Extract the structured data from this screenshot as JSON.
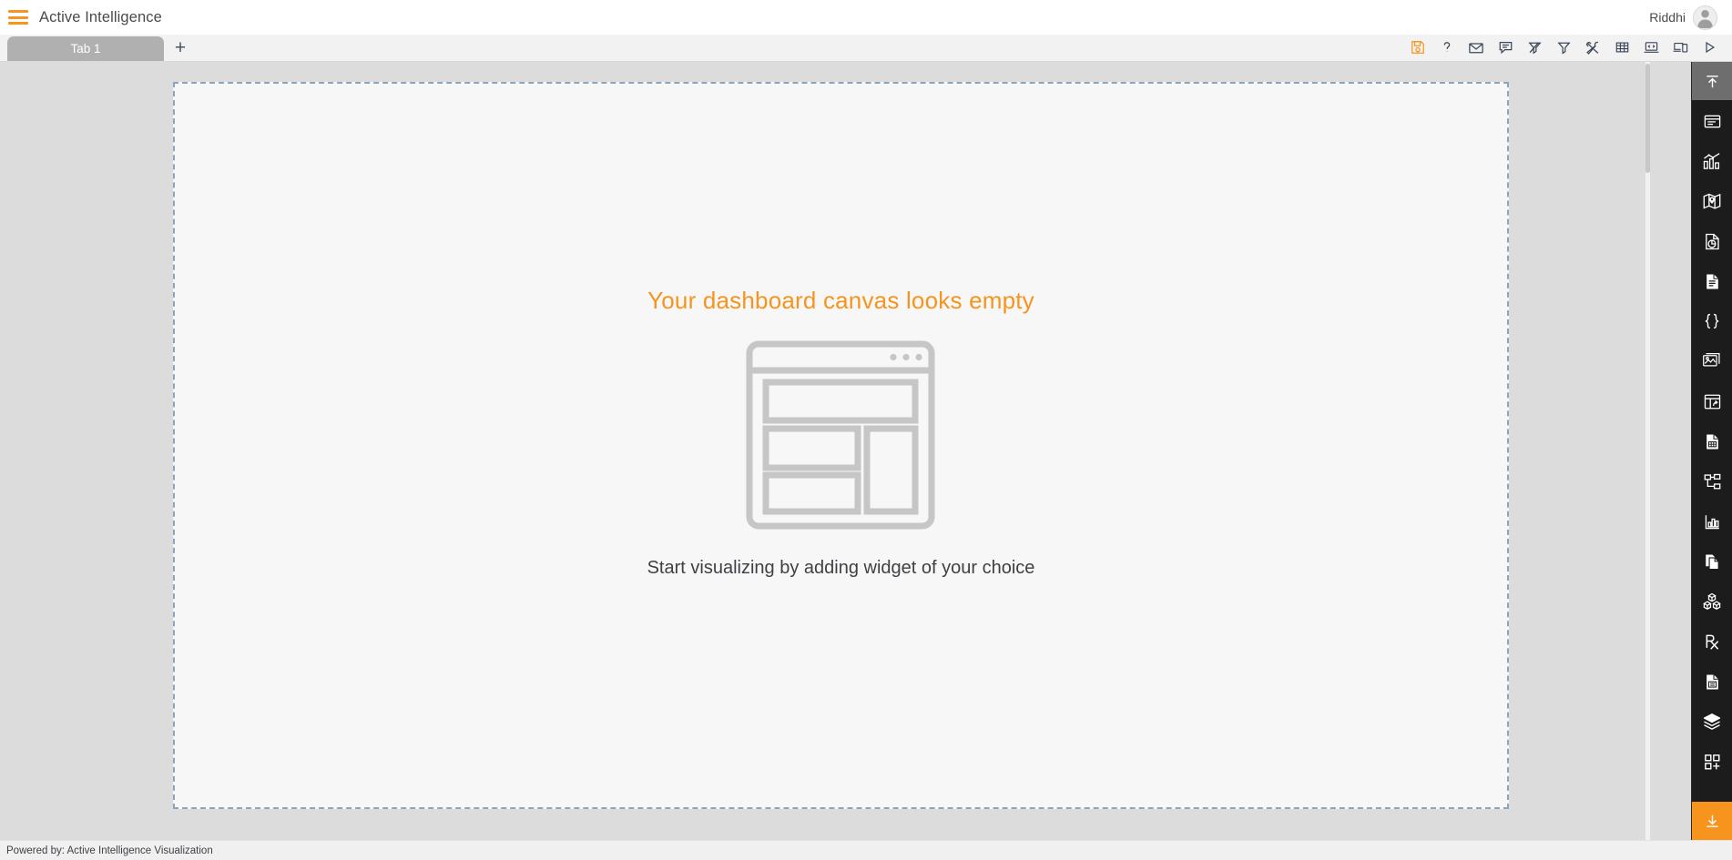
{
  "header": {
    "menu_icon": "hamburger-menu-icon",
    "title": "Active Intelligence",
    "user_name": "Riddhi",
    "avatar_icon": "user-avatar-icon"
  },
  "tabbar": {
    "tabs": [
      {
        "label": "Tab 1",
        "active": true
      }
    ],
    "add_tab_label": "+",
    "toolbar": [
      {
        "name": "save-icon",
        "title": "Save",
        "accent": true
      },
      {
        "name": "help-icon",
        "title": "Help",
        "accent": false
      },
      {
        "name": "mail-icon",
        "title": "Mail",
        "accent": false
      },
      {
        "name": "comment-icon",
        "title": "Comment",
        "accent": false
      },
      {
        "name": "clear-filter-icon",
        "title": "Clear Filter",
        "accent": false
      },
      {
        "name": "filter-icon",
        "title": "Filter",
        "accent": false
      },
      {
        "name": "tools-icon",
        "title": "Tools",
        "accent": false
      },
      {
        "name": "table-grid-icon",
        "title": "Table",
        "accent": false
      },
      {
        "name": "code-icon",
        "title": "Code",
        "accent": false
      },
      {
        "name": "devices-icon",
        "title": "Responsive View",
        "accent": false
      },
      {
        "name": "play-icon",
        "title": "Run",
        "accent": false
      }
    ]
  },
  "canvas": {
    "empty_title": "Your dashboard canvas looks empty",
    "empty_subtitle": "Start visualizing by adding widget of your choice",
    "illustration_name": "empty-dashboard-wireframe"
  },
  "sidebar": {
    "scroll_up": {
      "name": "scroll-up-icon",
      "title": "Scroll Up"
    },
    "items": [
      {
        "name": "widget-card-icon",
        "title": "Card Widget"
      },
      {
        "name": "bar-chart-icon",
        "title": "Chart Widget"
      },
      {
        "name": "map-icon",
        "title": "Map Widget"
      },
      {
        "name": "pie-report-icon",
        "title": "Report Widget"
      },
      {
        "name": "document-icon",
        "title": "Document Widget"
      },
      {
        "name": "json-braces-icon",
        "title": "JSON Widget"
      },
      {
        "name": "image-gallery-icon",
        "title": "Image Widget"
      },
      {
        "name": "panel-arrow-icon",
        "title": "Panel Widget"
      },
      {
        "name": "document-grid-icon",
        "title": "Grid Document Widget"
      },
      {
        "name": "hierarchy-tree-icon",
        "title": "Hierarchy Widget"
      },
      {
        "name": "column-chart-icon",
        "title": "Column Chart Widget"
      },
      {
        "name": "copy-document-icon",
        "title": "Duplicate Widget"
      },
      {
        "name": "cubes-icon",
        "title": "Cube Widget"
      },
      {
        "name": "prescription-icon",
        "title": "Rx Widget"
      },
      {
        "name": "document-list-icon",
        "title": "List Document Widget"
      },
      {
        "name": "layers-icon",
        "title": "Layers Widget"
      },
      {
        "name": "add-widget-icon",
        "title": "Add Widget"
      }
    ],
    "scroll_down": {
      "name": "scroll-down-icon",
      "title": "Scroll Down"
    }
  },
  "footer": {
    "text": "Powered by: Active Intelligence Visualization"
  },
  "colors": {
    "accent_orange": "#f7941e",
    "sidebar_dark": "#1c1c1c",
    "canvas_bg": "#f7f7f7",
    "canvas_border": "#8fa4bb",
    "page_bg": "#dcdcdc",
    "tab_active": "#b0b0b0"
  }
}
